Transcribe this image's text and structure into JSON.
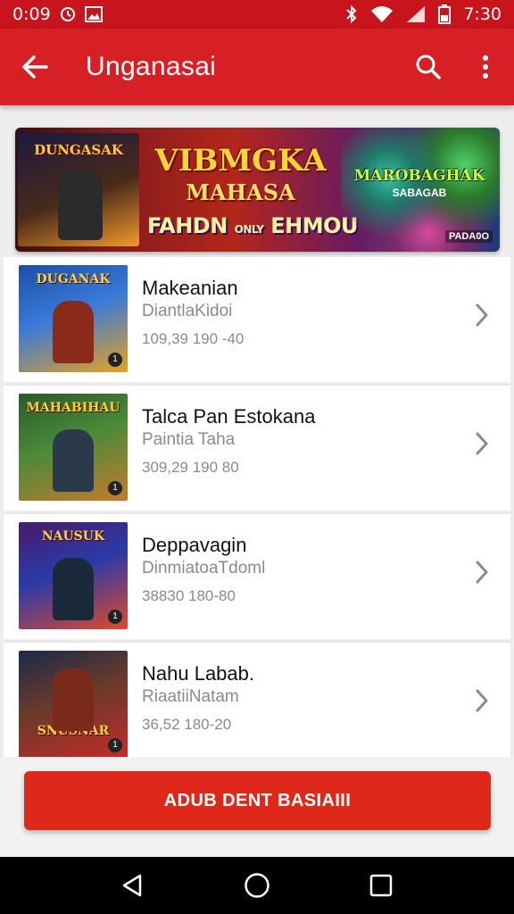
{
  "status_bar": {
    "left_time": "0:09",
    "right_time": "7:30",
    "icons": [
      "alarm-icon",
      "image-icon",
      "bluetooth-icon",
      "wifi-icon",
      "signal-icon",
      "battery-icon"
    ]
  },
  "app_bar": {
    "title": "Unganasai",
    "back_icon": "back-arrow-icon",
    "search_icon": "search-icon",
    "more_icon": "more-vert-icon"
  },
  "banner": {
    "thumb_title": "DUNGASAK",
    "title": "VIBMGKA",
    "subtitle": "MAHASA",
    "tagline": "FAHDN",
    "tagline_small": "ONLY",
    "tagline_end": "EHMOU",
    "art_title": "MAROBAGHAK",
    "art_sub": "SABAGAB",
    "badge": "PADA0O"
  },
  "items": [
    {
      "name": "Makeanian",
      "sub": "DiantlaKidoi",
      "meta": "109,39 190 -40",
      "cover_title": "DUGANAK",
      "colors": [
        "#1b4fa8",
        "#e6a21f"
      ]
    },
    {
      "name": "Talca Pan Estokana",
      "sub": "Paintia Taha",
      "meta": "309,29 190 80",
      "cover_title": "MAHABIHAU",
      "colors": [
        "#2b5a2a",
        "#c77a2a"
      ]
    },
    {
      "name": "Deppavagin",
      "sub": "DinmiatoaTdoml",
      "meta": "38830 180-80",
      "cover_title": "NAUSUK",
      "colors": [
        "#4a1a6a",
        "#e04a2a"
      ]
    },
    {
      "name": "Nahu Labab.",
      "sub": "RiaatiiNatam",
      "meta": "36,52 180-20",
      "cover_title": "SNUSNAR",
      "colors": [
        "#1a2a4a",
        "#c42a2a"
      ]
    }
  ],
  "cta": {
    "label": "ADUB DENT BASIAIII"
  },
  "nav": {
    "back": "nav-back-icon",
    "home": "nav-home-icon",
    "recents": "nav-recents-icon"
  },
  "colors": {
    "primary": "#d71f26",
    "status": "#c8141c",
    "cta": "#e0281a"
  }
}
